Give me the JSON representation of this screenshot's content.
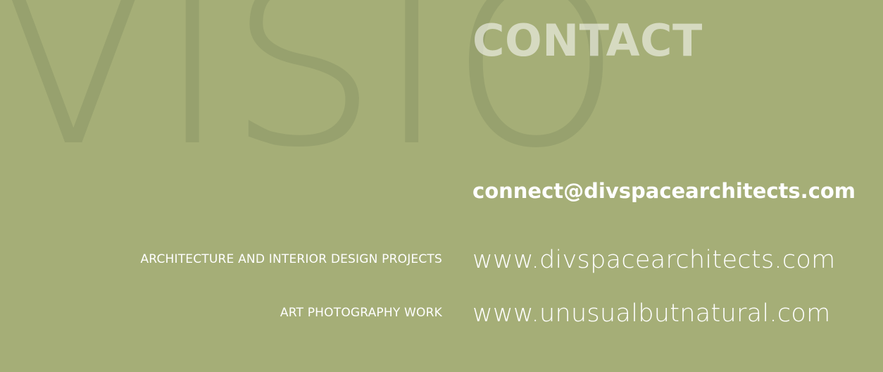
{
  "background": {
    "watermark_text": "visio",
    "color": "#a5ae77",
    "watermark_color": "#96a06e"
  },
  "contact": {
    "heading": "CONTACT",
    "email": "connect@divspacearchitects.com"
  },
  "links": [
    {
      "label": "ARCHITECTURE AND INTERIOR DESIGN PROJECTS",
      "url": "www.divspacearchitects.com"
    },
    {
      "label": "ART PHOTOGRAPHY WORK",
      "url": "www.unusualbutnatural.com"
    }
  ]
}
